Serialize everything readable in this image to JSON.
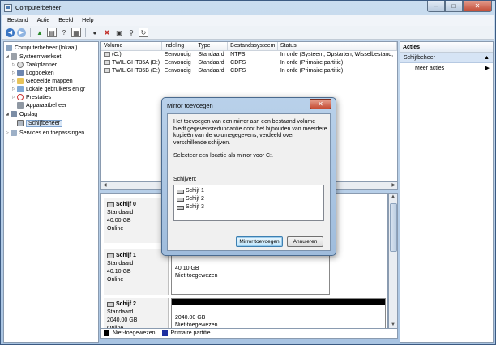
{
  "app": {
    "title": "Computerbeheer"
  },
  "menu": [
    "Bestand",
    "Actie",
    "Beeld",
    "Help"
  ],
  "tree": {
    "items": [
      {
        "label": "Computerbeheer (lokaal)",
        "icon": "computer-icon",
        "indent": 0,
        "toggle": ""
      },
      {
        "label": "Systeemwerkset",
        "icon": "tools-icon",
        "indent": 1,
        "toggle": "◢"
      },
      {
        "label": "Taakplanner",
        "icon": "clock-icon",
        "indent": 2,
        "toggle": "▷"
      },
      {
        "label": "Logboeken",
        "icon": "log-icon",
        "indent": 2,
        "toggle": "▷"
      },
      {
        "label": "Gedeelde mappen",
        "icon": "folder-icon",
        "indent": 2,
        "toggle": "▷"
      },
      {
        "label": "Lokale gebruikers en gr",
        "icon": "users-icon",
        "indent": 2,
        "toggle": "▷"
      },
      {
        "label": "Prestaties",
        "icon": "performance-icon",
        "indent": 2,
        "toggle": "▷"
      },
      {
        "label": "Apparaatbeheer",
        "icon": "device-icon",
        "indent": 2,
        "toggle": ""
      },
      {
        "label": "Opslag",
        "icon": "storage-icon",
        "indent": 1,
        "toggle": "◢"
      },
      {
        "label": "Schijfbeheer",
        "icon": "disk-icon",
        "indent": 2,
        "toggle": ""
      },
      {
        "label": "Services en toepassingen",
        "icon": "services-icon",
        "indent": 1,
        "toggle": "▷"
      }
    ]
  },
  "volumes": {
    "headers": [
      "Volume",
      "Indeling",
      "Type",
      "Bestandssysteem",
      "Status"
    ],
    "rows": [
      [
        "(C:)",
        "Eenvoudig",
        "Standaard",
        "NTFS",
        "In orde (Systeem, Opstarten, Wisselbestand,"
      ],
      [
        "TWILIGHT35A (D:)",
        "Eenvoudig",
        "Standaard",
        "CDFS",
        "In orde (Primaire partitie)"
      ],
      [
        "TWILIGHT35B (E:)",
        "Eenvoudig",
        "Standaard",
        "CDFS",
        "In orde (Primaire partitie)"
      ]
    ]
  },
  "disks": [
    {
      "name": "Schijf 0",
      "type": "Standaard",
      "size": "40.00 GB",
      "state": "Online",
      "part_size": "",
      "part_status": ""
    },
    {
      "name": "Schijf 1",
      "type": "Standaard",
      "size": "40.10 GB",
      "state": "Online",
      "part_size": "40.10 GB",
      "part_status": "Niet-toegewezen"
    },
    {
      "name": "Schijf 2",
      "type": "Standaard",
      "size": "2040.00 GB",
      "state": "Online",
      "part_size": "2040.00 GB",
      "part_status": "Niet-toegewezen"
    }
  ],
  "legend": [
    {
      "label": "Niet-toegewezen",
      "color": "#000000"
    },
    {
      "label": "Primaire partitie",
      "color": "#1c2fa0"
    }
  ],
  "actions": {
    "header": "Acties",
    "section": "Schijfbeheer",
    "item": "Meer acties"
  },
  "dialog": {
    "title": "Mirror toevoegen",
    "description": "Het toevoegen van een mirror aan een bestaand volume biedt gegevensredundantie door het bijhouden van meerdere kopieën van de volumegegevens, verdeeld over verschillende schijven.",
    "prompt": "Selecteer een locatie als mirror voor C:.",
    "list_label": "Schijven:",
    "disks": [
      "Schijf 1",
      "Schijf 2",
      "Schijf 3"
    ],
    "ok_label": "Mirror toevoegen",
    "cancel_label": "Annuleren"
  }
}
